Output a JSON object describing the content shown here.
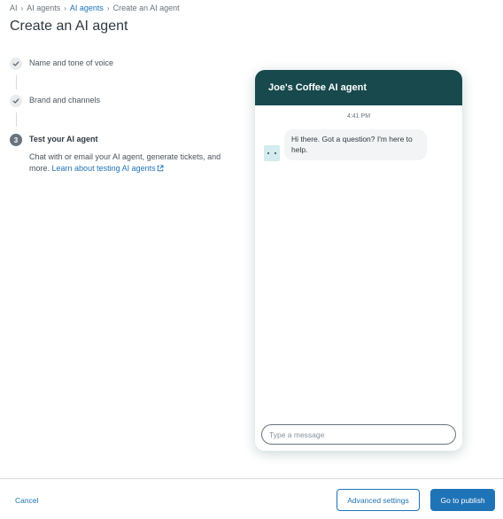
{
  "breadcrumb": {
    "items": [
      "AI",
      "AI agents",
      "AI agents",
      "Create an AI agent"
    ]
  },
  "page": {
    "title": "Create an AI agent"
  },
  "steps": [
    {
      "label": "Name and tone of voice",
      "status": "complete"
    },
    {
      "label": "Brand and channels",
      "status": "complete"
    },
    {
      "number": "3",
      "label": "Test your AI agent",
      "status": "current"
    }
  ],
  "step_description": {
    "text": "Chat with or email your AI agent, generate tickets, and more.",
    "link": "Learn about testing AI agents"
  },
  "chat": {
    "title": "Joe's Coffee AI agent",
    "time": "4:41 PM",
    "message": "Hi there. Got a question? I'm here to help.",
    "input_placeholder": "Type a message"
  },
  "footer": {
    "cancel": "Cancel",
    "advanced": "Advanced settings",
    "publish": "Go to publish"
  },
  "colors": {
    "link": "#1f73b7",
    "chat_header": "#17494d",
    "primary_button": "#1f73b7"
  }
}
